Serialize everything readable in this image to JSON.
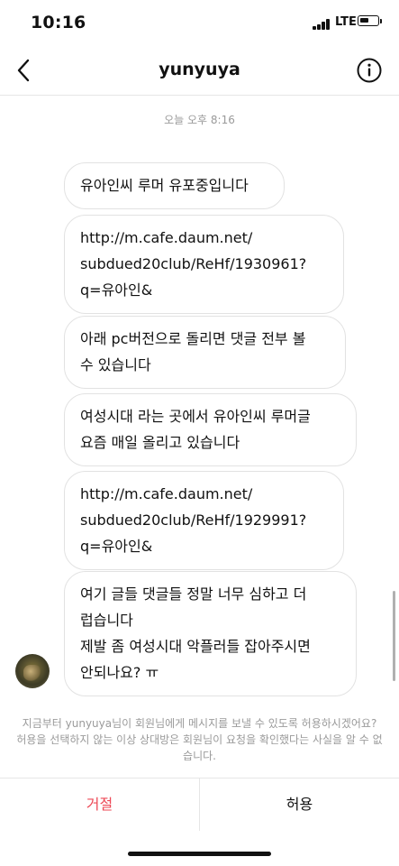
{
  "status_bar": {
    "time": "10:16",
    "network": "LTE",
    "battery_fraction": 0.55
  },
  "nav": {
    "title": "yunyuya"
  },
  "timestamp": "오늘 오후 8:16",
  "messages": [
    {
      "text": "유아인씨 루머 유포중입니다"
    },
    {
      "text": "http://m.cafe.daum.net/\nsubdued20club/ReHf/1930961?\nq=유아인&"
    },
    {
      "text": "아래 pc버전으로 돌리면 댓글 전부 볼\n수 있습니다"
    },
    {
      "text": "여성시대 라는 곳에서 유아인씨 루머글\n요즘 매일 올리고 있습니다"
    },
    {
      "text": "http://m.cafe.daum.net/\nsubdued20club/ReHf/1929991?\nq=유아인&"
    },
    {
      "text": "여기 글들 댓글들 정말 너무 심하고 더\n럽습니다\n제발 좀 여성시대 악플러들 잡아주시면\n안되나요? ㅠ"
    }
  ],
  "notice": "지금부터 yunyuya님이 회원님에게 메시지를 보낼 수 있도록 허용하시겠어요? 허용을 선택하지 않는 이상 상대방은 회원님이 요청을 확인했다는 사실을 알 수 없습니다.",
  "actions": {
    "decline_label": "거절",
    "allow_label": "허용"
  },
  "colors": {
    "decline": "#ed4956",
    "divider": "#e6e6e6"
  }
}
